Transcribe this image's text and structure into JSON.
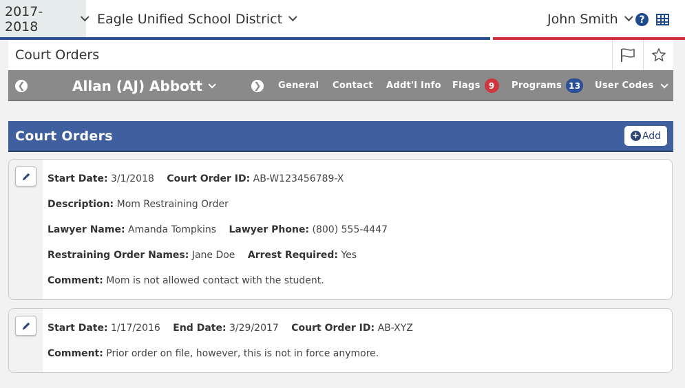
{
  "topbar": {
    "school_year": "2017-2018",
    "district": "Eagle Unified School District",
    "user": "John Smith",
    "help_icon": "?",
    "colors": {
      "blue": "#2d4f96",
      "red": "#c8323a"
    }
  },
  "page": {
    "title": "Court Orders"
  },
  "student": {
    "name": "Allan (AJ) Abbott",
    "nav": [
      {
        "label": "General"
      },
      {
        "label": "Contact"
      },
      {
        "label": "Addt'l Info"
      },
      {
        "label": "Flags",
        "badge": "9"
      },
      {
        "label": "Programs",
        "badge": "13"
      },
      {
        "label": "User Codes"
      }
    ]
  },
  "section": {
    "title": "Court Orders",
    "add_label": "Add"
  },
  "records": [
    {
      "rows": [
        [
          {
            "label": "Start Date:",
            "value": "3/1/2018"
          },
          {
            "label": "Court Order ID:",
            "value": "AB-W123456789-X"
          }
        ],
        [
          {
            "label": "Description:",
            "value": "Mom Restraining Order"
          }
        ],
        [
          {
            "label": "Lawyer Name:",
            "value": "Amanda Tompkins"
          },
          {
            "label": "Lawyer Phone:",
            "value": "(800) 555-4447"
          }
        ],
        [
          {
            "label": "Restraining Order Names:",
            "value": "Jane Doe"
          },
          {
            "label": "Arrest Required:",
            "value": "Yes"
          }
        ],
        [
          {
            "label": "Comment:",
            "value": "Mom is not allowed contact with the student."
          }
        ]
      ]
    },
    {
      "rows": [
        [
          {
            "label": "Start Date:",
            "value": "1/17/2016"
          },
          {
            "label": "End Date:",
            "value": "3/29/2017"
          },
          {
            "label": "Court Order ID:",
            "value": "AB-XYZ"
          }
        ],
        [
          {
            "label": "Comment:",
            "value": "Prior order on file, however, this is not in force anymore."
          }
        ]
      ]
    }
  ]
}
